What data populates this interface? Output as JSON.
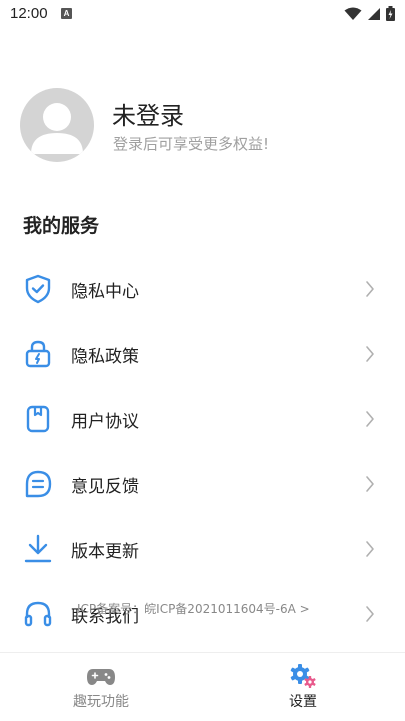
{
  "status_bar": {
    "time": "12:00",
    "notification_glyph": "A",
    "icons": [
      "wifi-icon",
      "signal-icon",
      "battery-icon"
    ]
  },
  "profile": {
    "name": "未登录",
    "subtitle": "登录后可享受更多权益!"
  },
  "section_title": "我的服务",
  "menu": [
    {
      "label": "隐私中心",
      "icon": "shield-check-icon"
    },
    {
      "label": "隐私政策",
      "icon": "lock-icon"
    },
    {
      "label": "用户协议",
      "icon": "document-icon"
    },
    {
      "label": "意见反馈",
      "icon": "message-icon"
    },
    {
      "label": "版本更新",
      "icon": "download-icon"
    },
    {
      "label": "联系我们",
      "icon": "headphones-icon"
    }
  ],
  "icp": "ICP备案号：皖ICP备2021011604号-6A >",
  "tabs": [
    {
      "label": "趣玩功能",
      "icon": "gamepad-icon",
      "active": false
    },
    {
      "label": "设置",
      "icon": "gear-icon",
      "active": true
    }
  ],
  "colors": {
    "accent": "#3a8ee6",
    "gear_pink": "#e85a8c",
    "inactive": "#888888",
    "text": "#222222"
  }
}
